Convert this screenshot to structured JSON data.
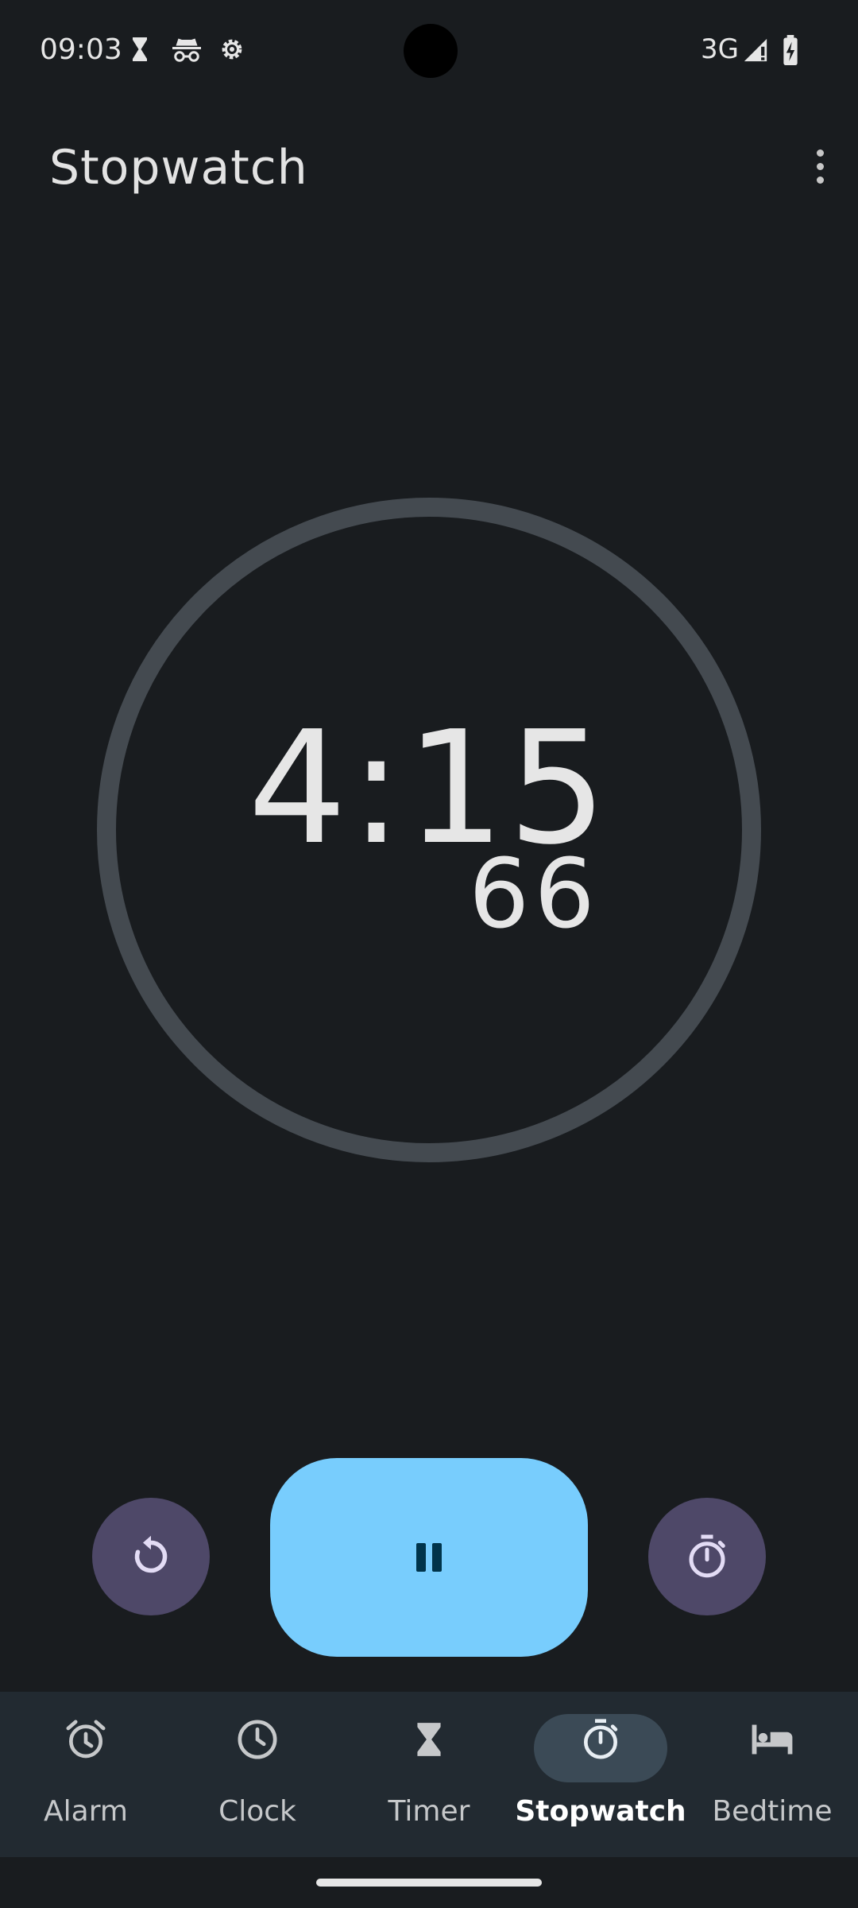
{
  "status_bar": {
    "time": "09:03",
    "network": "3G",
    "icons": [
      "hourglass-icon",
      "incognito-icon",
      "gear-icon",
      "signal-icon",
      "battery-charging-icon"
    ]
  },
  "header": {
    "title": "Stopwatch",
    "menu_icon": "overflow-menu-icon"
  },
  "stopwatch": {
    "time": "4:15",
    "hundredths": "66"
  },
  "controls": {
    "reset_icon": "reset-icon",
    "pause_icon": "pause-icon",
    "lap_icon": "stopwatch-lap-icon",
    "colors": {
      "primary": "#78cdfd",
      "secondary": "#4e4868"
    }
  },
  "bottom_nav": {
    "items": [
      {
        "label": "Alarm",
        "icon": "alarm-icon"
      },
      {
        "label": "Clock",
        "icon": "clock-icon"
      },
      {
        "label": "Timer",
        "icon": "hourglass-icon"
      },
      {
        "label": "Stopwatch",
        "icon": "stopwatch-icon"
      },
      {
        "label": "Bedtime",
        "icon": "bed-icon"
      }
    ],
    "active": "Stopwatch"
  }
}
